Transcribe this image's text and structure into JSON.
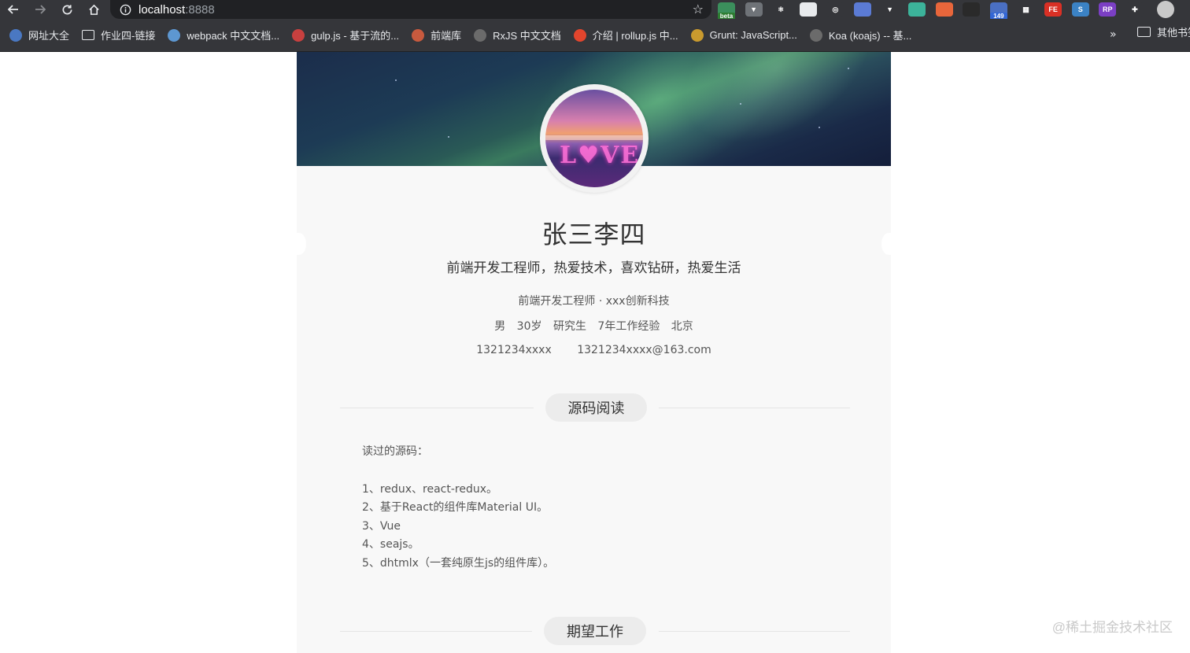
{
  "browser": {
    "url_host": "localhost",
    "url_port": ":8888",
    "extensions": [
      {
        "name": "beta-ext-icon",
        "label": "",
        "badge": "beta",
        "color": "#3b8f5c",
        "badge_color": "#2e7d32"
      },
      {
        "name": "vue-devtools-icon",
        "label": "▼",
        "color": "#6f7378"
      },
      {
        "name": "react-devtools-icon",
        "label": "⚛",
        "color": "#35363a"
      },
      {
        "name": "circle-ext-icon",
        "label": "",
        "color": "#e8eaed"
      },
      {
        "name": "target-ext-icon",
        "label": "◎",
        "color": "#35363a"
      },
      {
        "name": "blue-ext-icon",
        "label": "",
        "color": "#5b7bd5"
      },
      {
        "name": "triangle-ext-icon",
        "label": "▼",
        "color": "#35363a"
      },
      {
        "name": "green-ext-icon",
        "label": "",
        "color": "#3cb39a"
      },
      {
        "name": "orange-ext-icon",
        "label": "",
        "color": "#e8663b"
      },
      {
        "name": "dark-ext-icon",
        "label": "",
        "color": "#2a2a2a"
      },
      {
        "name": "counter-ext-icon",
        "label": "",
        "badge": "149",
        "color": "#4a6fc2",
        "badge_color": "#3367d6"
      },
      {
        "name": "qr-ext-icon",
        "label": "▦",
        "color": "#35363a"
      },
      {
        "name": "fe-ext-icon",
        "label": "FE",
        "color": "#d93025"
      },
      {
        "name": "s-ext-icon",
        "label": "S",
        "color": "#3b82c4"
      },
      {
        "name": "rp-ext-icon",
        "label": "RP",
        "color": "#7b3fc4"
      },
      {
        "name": "puzzle-icon",
        "label": "✚",
        "color": "#35363a"
      }
    ]
  },
  "bookmarks": [
    {
      "label": "网址大全",
      "icon": "globe-icon",
      "color": "#4a78c2"
    },
    {
      "label": "作业四-链接",
      "icon": "folder-icon",
      "color": ""
    },
    {
      "label": "webpack 中文文档...",
      "icon": "webpack-icon",
      "color": "#5d97d1"
    },
    {
      "label": "gulp.js - 基于流的...",
      "icon": "gulp-icon",
      "color": "#c8403f"
    },
    {
      "label": "前端库",
      "icon": "angular-icon",
      "color": "#c85a3e"
    },
    {
      "label": "RxJS 中文文档",
      "icon": "globe-icon",
      "color": "#6b6b6b"
    },
    {
      "label": "介绍 | rollup.js 中...",
      "icon": "rollup-icon",
      "color": "#e2452d"
    },
    {
      "label": "Grunt: JavaScript...",
      "icon": "grunt-icon",
      "color": "#c99a2e"
    },
    {
      "label": "Koa (koajs) -- 基...",
      "icon": "globe-icon",
      "color": "#6b6b6b"
    }
  ],
  "bookmarks_overflow": "»",
  "bookmarks_other": "其他书签",
  "profile": {
    "name": "张三李四",
    "motto": "前端开发工程师，热爱技术，喜欢钻研，热爱生活",
    "job": "前端开发工程师 · xxx创新科技",
    "info": [
      "男",
      "30岁",
      "研究生",
      "7年工作经验",
      "北京"
    ],
    "phone": "1321234xxxx",
    "email": "1321234xxxx@163.com"
  },
  "sections": [
    {
      "title": "源码阅读",
      "intro": "读过的源码：",
      "items": [
        "1、redux、react-redux。",
        "2、基于React的组件库Material UI。",
        "3、Vue",
        "4、seajs。",
        "5、dhtmlx（一套纯原生js的组件库）。"
      ]
    },
    {
      "title": "期望工作"
    }
  ],
  "watermark": "@稀土掘金技术社区"
}
